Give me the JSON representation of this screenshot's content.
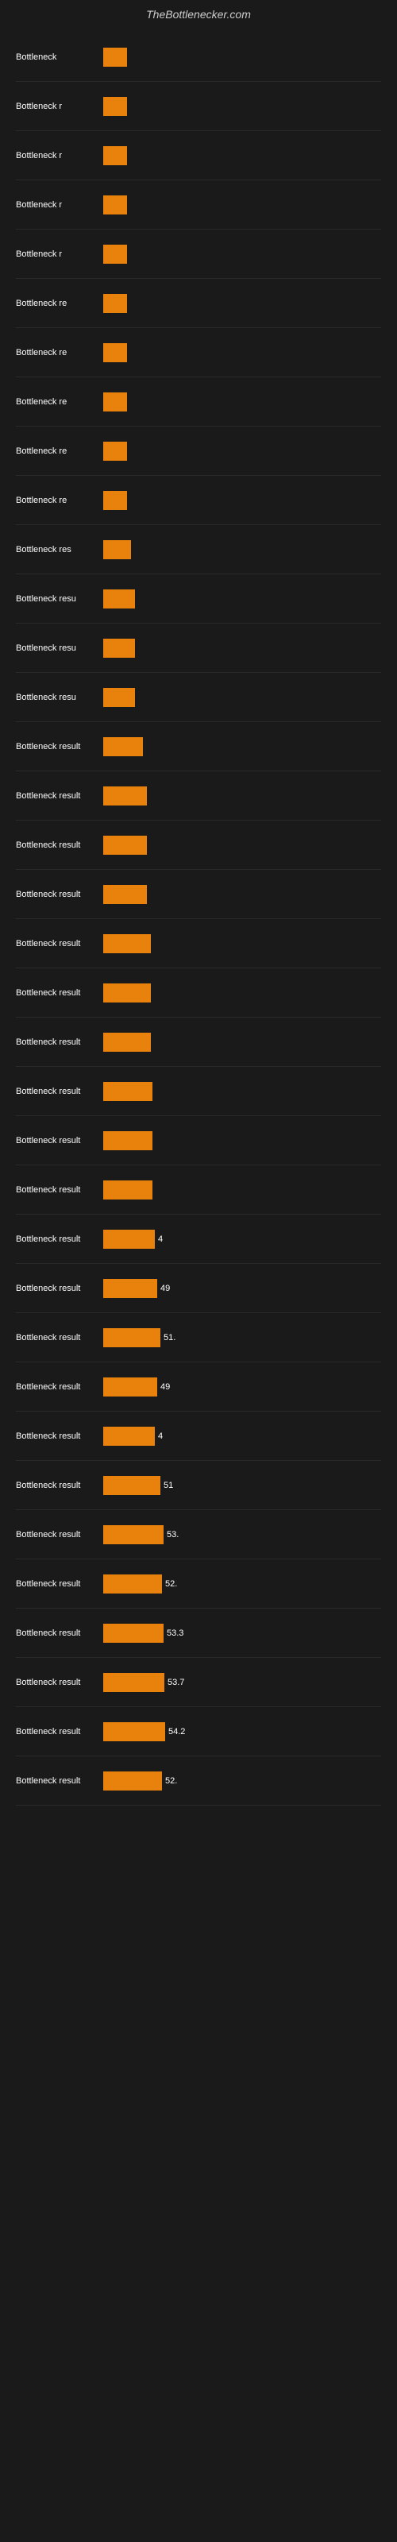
{
  "header": {
    "title": "TheBottlenecker.com"
  },
  "bars": [
    {
      "label": "Bottleneck",
      "value": null,
      "width": 30
    },
    {
      "label": "Bottleneck r",
      "value": null,
      "width": 30
    },
    {
      "label": "Bottleneck r",
      "value": null,
      "width": 30
    },
    {
      "label": "Bottleneck r",
      "value": null,
      "width": 30
    },
    {
      "label": "Bottleneck r",
      "value": null,
      "width": 30
    },
    {
      "label": "Bottleneck re",
      "value": null,
      "width": 30
    },
    {
      "label": "Bottleneck re",
      "value": null,
      "width": 30
    },
    {
      "label": "Bottleneck re",
      "value": null,
      "width": 30
    },
    {
      "label": "Bottleneck re",
      "value": null,
      "width": 30
    },
    {
      "label": "Bottleneck re",
      "value": null,
      "width": 30
    },
    {
      "label": "Bottleneck res",
      "value": null,
      "width": 35
    },
    {
      "label": "Bottleneck resu",
      "value": null,
      "width": 40
    },
    {
      "label": "Bottleneck resu",
      "value": null,
      "width": 40
    },
    {
      "label": "Bottleneck resu",
      "value": null,
      "width": 40
    },
    {
      "label": "Bottleneck result",
      "value": null,
      "width": 50
    },
    {
      "label": "Bottleneck result",
      "value": null,
      "width": 55
    },
    {
      "label": "Bottleneck result",
      "value": null,
      "width": 55
    },
    {
      "label": "Bottleneck result",
      "value": null,
      "width": 55
    },
    {
      "label": "Bottleneck result",
      "value": null,
      "width": 60
    },
    {
      "label": "Bottleneck result",
      "value": null,
      "width": 60
    },
    {
      "label": "Bottleneck result",
      "value": null,
      "width": 60
    },
    {
      "label": "Bottleneck result",
      "value": null,
      "width": 62
    },
    {
      "label": "Bottleneck result",
      "value": null,
      "width": 62
    },
    {
      "label": "Bottleneck result",
      "value": null,
      "width": 62
    },
    {
      "label": "Bottleneck result",
      "value": "4",
      "width": 65
    },
    {
      "label": "Bottleneck result",
      "value": "49",
      "width": 68
    },
    {
      "label": "Bottleneck result",
      "value": "51.",
      "width": 72
    },
    {
      "label": "Bottleneck result",
      "value": "49",
      "width": 68
    },
    {
      "label": "Bottleneck result",
      "value": "4",
      "width": 65
    },
    {
      "label": "Bottleneck result",
      "value": "51",
      "width": 72
    },
    {
      "label": "Bottleneck result",
      "value": "53.",
      "width": 76
    },
    {
      "label": "Bottleneck result",
      "value": "52.",
      "width": 74
    },
    {
      "label": "Bottleneck result",
      "value": "53.3",
      "width": 76
    },
    {
      "label": "Bottleneck result",
      "value": "53.7",
      "width": 77
    },
    {
      "label": "Bottleneck result",
      "value": "54.2",
      "width": 78
    },
    {
      "label": "Bottleneck result",
      "value": "52.",
      "width": 74
    }
  ]
}
